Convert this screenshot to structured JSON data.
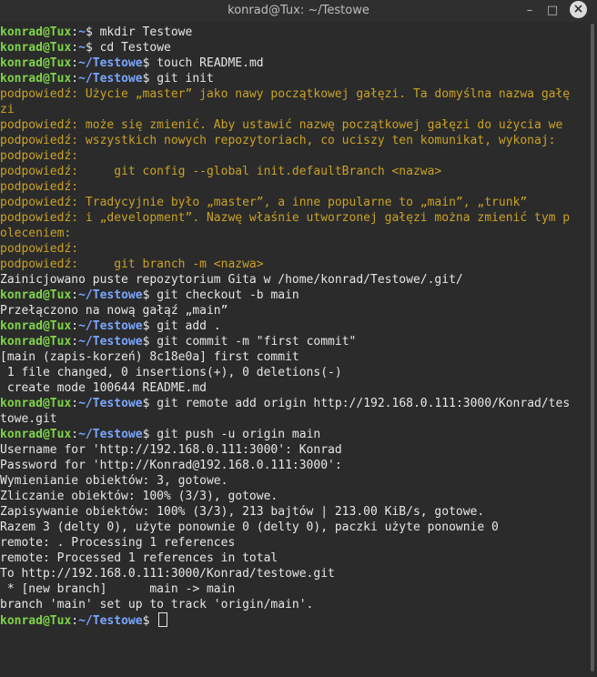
{
  "window": {
    "title": "konrad@Tux: ~/Testowe",
    "minimize_glyph": "–",
    "maximize_glyph": "□",
    "close_glyph": "×"
  },
  "prompt": {
    "user_host": "konrad@Tux",
    "sep": ":",
    "dollar": "$ "
  },
  "lines": [
    {
      "type": "prompt",
      "path": "~",
      "cmd": "mkdir Testowe"
    },
    {
      "type": "prompt",
      "path": "~",
      "cmd": "cd Testowe"
    },
    {
      "type": "prompt",
      "path": "~/Testowe",
      "cmd": "touch README.md"
    },
    {
      "type": "prompt",
      "path": "~/Testowe",
      "cmd": "git init"
    },
    {
      "type": "hint",
      "text": "podpowiedź: Użycie „master” jako nawy początkowej gałęzi. Ta domyślna nazwa gałę"
    },
    {
      "type": "hint",
      "text": "zi"
    },
    {
      "type": "hint",
      "text": "podpowiedź: może się zmienić. Aby ustawić nazwę początkowej gałęzi do użycia we"
    },
    {
      "type": "hint",
      "text": "podpowiedź: wszystkich nowych repozytoriach, co uciszy ten komunikat, wykonaj:"
    },
    {
      "type": "hint",
      "text": "podpowiedź:"
    },
    {
      "type": "hint",
      "text": "podpowiedź:     git config --global init.defaultBranch <nazwa>"
    },
    {
      "type": "hint",
      "text": "podpowiedź:"
    },
    {
      "type": "hint",
      "text": "podpowiedź: Tradycyjnie było „master”, a inne popularne to „main”, „trunk”"
    },
    {
      "type": "hint",
      "text": "podpowiedź: i „development”. Nazwę właśnie utworzonej gałęzi można zmienić tym p"
    },
    {
      "type": "hint",
      "text": "oleceniem:"
    },
    {
      "type": "hint",
      "text": "podpowiedź:"
    },
    {
      "type": "hint",
      "text": "podpowiedź:     git branch -m <nazwa>"
    },
    {
      "type": "out",
      "text": "Zainicjowano puste repozytorium Gita w /home/konrad/Testowe/.git/"
    },
    {
      "type": "prompt",
      "path": "~/Testowe",
      "cmd": "git checkout -b main"
    },
    {
      "type": "out",
      "text": "Przełączono na nową gałąź „main”"
    },
    {
      "type": "prompt",
      "path": "~/Testowe",
      "cmd": "git add ."
    },
    {
      "type": "prompt",
      "path": "~/Testowe",
      "cmd": "git commit -m \"first commit\""
    },
    {
      "type": "out",
      "text": "[main (zapis-korzeń) 8c18e0a] first commit"
    },
    {
      "type": "out",
      "text": " 1 file changed, 0 insertions(+), 0 deletions(-)"
    },
    {
      "type": "out",
      "text": " create mode 100644 README.md"
    },
    {
      "type": "prompt",
      "path": "~/Testowe",
      "cmd": "git remote add origin http://192.168.0.111:3000/Konrad/tes"
    },
    {
      "type": "out",
      "text": "towe.git"
    },
    {
      "type": "prompt",
      "path": "~/Testowe",
      "cmd": "git push -u origin main"
    },
    {
      "type": "out",
      "text": "Username for 'http://192.168.0.111:3000': Konrad"
    },
    {
      "type": "out",
      "text": "Password for 'http://Konrad@192.168.0.111:3000':"
    },
    {
      "type": "out",
      "text": "Wymienianie obiektów: 3, gotowe."
    },
    {
      "type": "out",
      "text": "Zliczanie obiektów: 100% (3/3), gotowe."
    },
    {
      "type": "out",
      "text": "Zapisywanie obiektów: 100% (3/3), 213 bajtów | 213.00 KiB/s, gotowe."
    },
    {
      "type": "out",
      "text": "Razem 3 (delty 0), użyte ponownie 0 (delty 0), paczki użyte ponownie 0"
    },
    {
      "type": "out",
      "text": "remote: . Processing 1 references"
    },
    {
      "type": "out",
      "text": "remote: Processed 1 references in total"
    },
    {
      "type": "out",
      "text": "To http://192.168.0.111:3000/Konrad/testowe.git"
    },
    {
      "type": "out",
      "text": " * [new branch]      main -> main"
    },
    {
      "type": "out",
      "text": "branch 'main' set up to track 'origin/main'."
    },
    {
      "type": "prompt",
      "path": "~/Testowe",
      "cmd": "",
      "cursor": true
    }
  ],
  "colors": {
    "background": "#2b2b2b",
    "user_host": "#7fd34a",
    "path": "#7aa6ff",
    "hint": "#c9a227",
    "text": "#e6e6e6"
  }
}
